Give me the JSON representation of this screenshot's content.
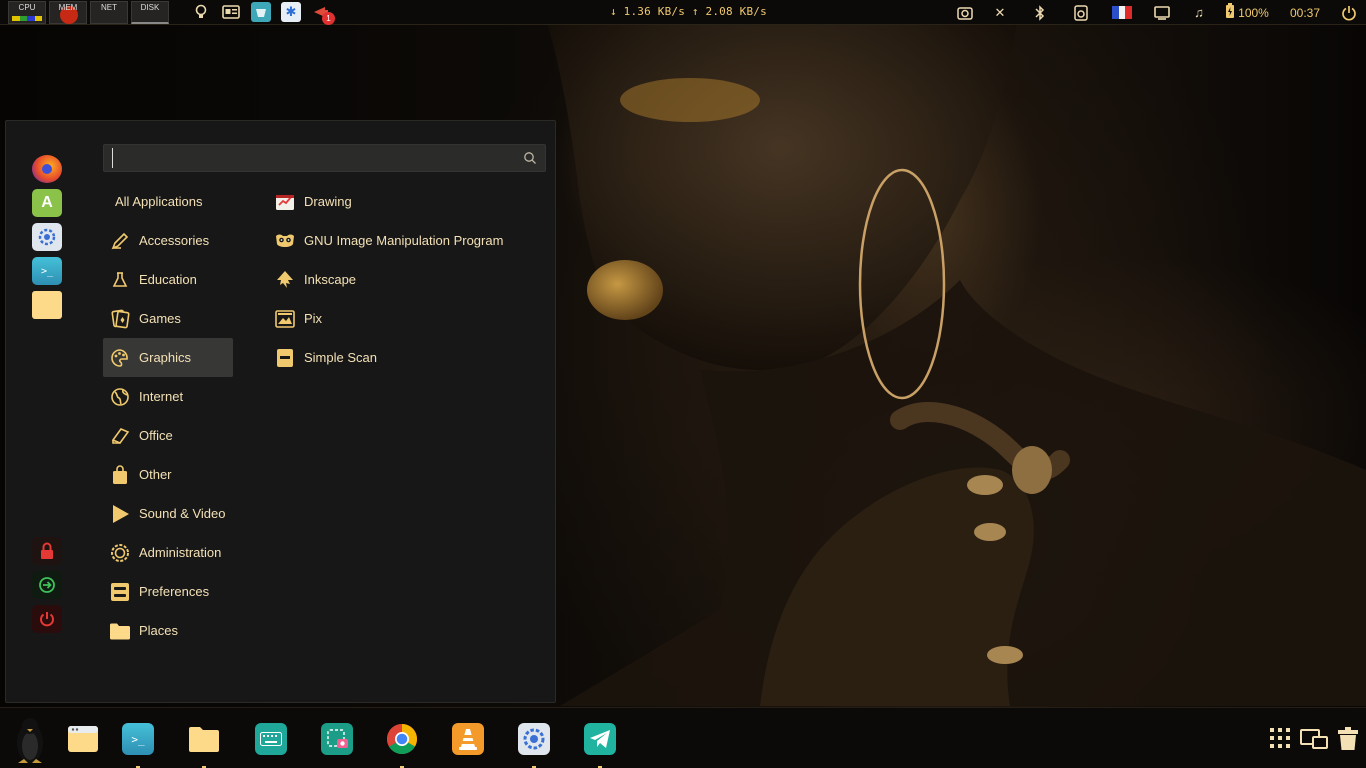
{
  "top_panel": {
    "monitors": [
      {
        "label": "CPU"
      },
      {
        "label": "MEM"
      },
      {
        "label": "NET"
      },
      {
        "label": "DISK"
      }
    ],
    "tray_left_icons": [
      "lightbulb-icon",
      "news-icon",
      "window-app-icon",
      "flower-app-icon",
      "notification-app-icon"
    ],
    "notification_count": "1",
    "net_speed": "↓ 1.36 KB/s ↑ 2.08 KB/s",
    "tray_right_icons": [
      "screenshot-icon",
      "close-icon",
      "bluetooth-icon",
      "audio-device-icon",
      "flag-fr-icon",
      "display-icon",
      "music-icon",
      "battery-icon",
      "power-icon"
    ],
    "battery": "100%",
    "clock": "00:37"
  },
  "menu": {
    "search": {
      "value": "",
      "placeholder": ""
    },
    "favorites": [
      "firefox-icon",
      "software-store-icon",
      "settings-icon",
      "terminal-icon",
      "files-icon"
    ],
    "session_buttons": [
      "lock-icon",
      "logout-icon",
      "shutdown-icon"
    ],
    "categories": [
      {
        "label": "All Applications",
        "icon": ""
      },
      {
        "label": "Accessories",
        "icon": "accessories-icon"
      },
      {
        "label": "Education",
        "icon": "education-icon"
      },
      {
        "label": "Games",
        "icon": "games-icon"
      },
      {
        "label": "Graphics",
        "icon": "graphics-icon"
      },
      {
        "label": "Internet",
        "icon": "internet-icon"
      },
      {
        "label": "Office",
        "icon": "office-icon"
      },
      {
        "label": "Other",
        "icon": "other-icon"
      },
      {
        "label": "Sound & Video",
        "icon": "sound-video-icon"
      },
      {
        "label": "Administration",
        "icon": "administration-icon"
      },
      {
        "label": "Preferences",
        "icon": "preferences-icon"
      },
      {
        "label": "Places",
        "icon": "places-icon"
      }
    ],
    "selected_category": "Graphics",
    "apps": [
      {
        "label": "Drawing",
        "icon": "drawing-icon"
      },
      {
        "label": "GNU Image Manipulation Program",
        "icon": "gimp-icon"
      },
      {
        "label": "Inkscape",
        "icon": "inkscape-icon"
      },
      {
        "label": "Pix",
        "icon": "pix-icon"
      },
      {
        "label": "Simple Scan",
        "icon": "simple-scan-icon"
      }
    ]
  },
  "dock": {
    "items": [
      "menu-tux-icon",
      "file-manager-window-icon",
      "terminal-icon",
      "files-icon",
      "keyboard-icon",
      "screenshot-app-icon",
      "chrome-icon",
      "vlc-icon",
      "settings-icon",
      "telegram-icon"
    ],
    "right_icons": [
      "app-grid-icon",
      "workspaces-icon",
      "trash-icon"
    ]
  },
  "colors": {
    "accent": "#f0c96e",
    "menu_bg": "#181818",
    "selected_bg": "#373736",
    "panel_bg": "#0b0a09"
  }
}
